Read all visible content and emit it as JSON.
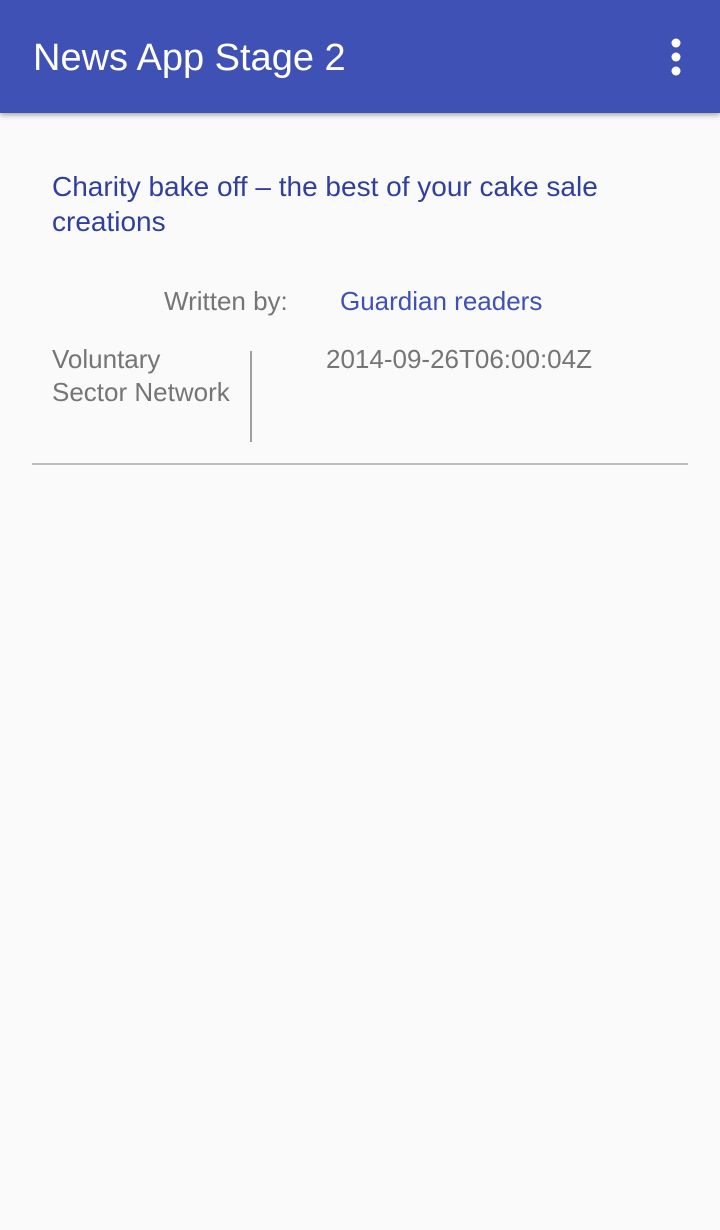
{
  "app_bar": {
    "title": "News App Stage 2",
    "menu_icon": "more-vert-icon",
    "color": "#3F51B5"
  },
  "articles": [
    {
      "title": "Charity bake off – the best of your cake sale creations",
      "written_by_label": "Written by:",
      "author": "Guardian readers",
      "section": "Voluntary Sector Network",
      "date": "2014-09-26T06:00:04Z"
    }
  ],
  "colors": {
    "title_text": "#303F9F",
    "author_text": "#3F51B5",
    "secondary_text": "#757575",
    "background": "#FAFAFA"
  }
}
